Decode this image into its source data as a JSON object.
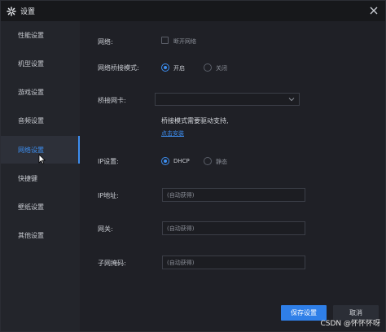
{
  "window": {
    "title": "设置",
    "icon": "gear-icon",
    "close_icon": "close-icon"
  },
  "sidebar": {
    "items": [
      {
        "label": "性能设置",
        "active": false
      },
      {
        "label": "机型设置",
        "active": false
      },
      {
        "label": "游戏设置",
        "active": false
      },
      {
        "label": "音频设置",
        "active": false
      },
      {
        "label": "网络设置",
        "active": true
      },
      {
        "label": "快捷键",
        "active": false
      },
      {
        "label": "壁纸设置",
        "active": false
      },
      {
        "label": "其他设置",
        "active": false
      }
    ]
  },
  "network": {
    "label": "网络:",
    "disconnect_label": "断开网络",
    "disconnect_checked": false
  },
  "bridge_mode": {
    "label": "网络桥接模式:",
    "on_label": "开启",
    "off_label": "关闭",
    "selected": "开启"
  },
  "bridge_nic": {
    "label": "桥接网卡:",
    "value": ""
  },
  "driver": {
    "note": "桥接模式需要驱动支持,",
    "install_link": "点击安装"
  },
  "ip_settings": {
    "label": "IP设置:",
    "dhcp_label": "DHCP",
    "static_label": "静态",
    "selected": "DHCP"
  },
  "ip_address": {
    "label": "IP地址:",
    "value": "(自动获得)"
  },
  "gateway": {
    "label": "网关:",
    "value": "(自动获得)"
  },
  "subnet_mask": {
    "label": "子网掩码:",
    "value": "(自动获得)"
  },
  "footer": {
    "save_label": "保存设置",
    "cancel_label": "取消"
  },
  "watermark": "CSDN @怀怀怀呀",
  "colors": {
    "accent": "#3d8ef0",
    "background": "#1f2026",
    "sidebar": "#23252b",
    "titlebar": "#17181b"
  }
}
